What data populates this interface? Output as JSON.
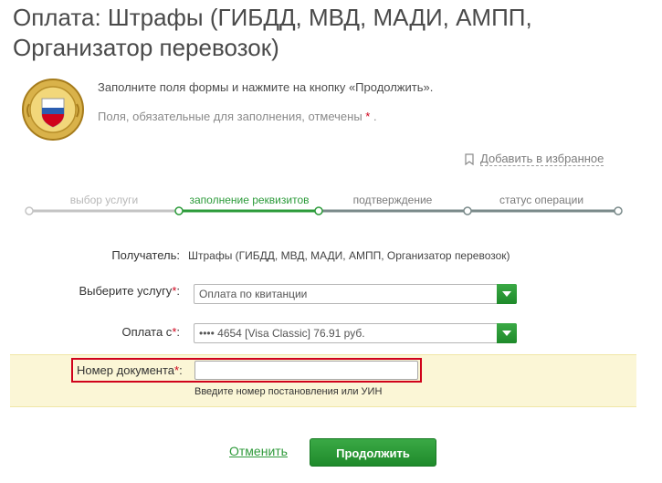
{
  "page": {
    "title": "Оплата: Штрафы (ГИБДД, МВД, МАДИ, АМПП, Организатор перевозок)",
    "intro": "Заполните поля формы и нажмите на кнопку «Продолжить».",
    "required_note": "Поля, обязательные для заполнения, отмечены",
    "required_star": "*",
    "required_end": "."
  },
  "favorites": {
    "label": "Добавить в избранное",
    "icon": "bookmark-icon"
  },
  "steps": [
    {
      "label": "выбор услуги",
      "state": "done"
    },
    {
      "label": "заполнение реквизитов",
      "state": "active"
    },
    {
      "label": "подтверждение",
      "state": "next"
    },
    {
      "label": "статус операции",
      "state": "next"
    }
  ],
  "form": {
    "recipient_label": "Получатель:",
    "recipient_value": "Штрафы (ГИБДД, МВД, МАДИ, АМПП, Организатор перевозок)",
    "service_label": "Выберите услугу",
    "service_value": "Оплата по квитанции",
    "pay_from_label": "Оплата с",
    "pay_from_value": "•••• 4654  [Visa Classic]  76.91 руб.",
    "doc_label": "Номер документа",
    "doc_value": "",
    "doc_hint": "Введите номер постановления или УИН",
    "star": "*",
    "colon": ":"
  },
  "actions": {
    "cancel": "Отменить",
    "continue": "Продолжить"
  },
  "colors": {
    "accent": "#2c9b3a",
    "required": "#d0021b",
    "highlight": "#fbf6d6"
  }
}
